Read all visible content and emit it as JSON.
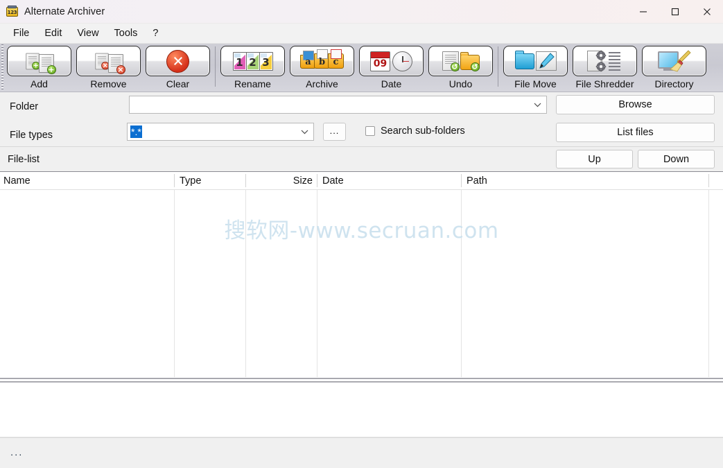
{
  "window": {
    "title": "Alternate Archiver",
    "icon": "archiver-123-icon",
    "controls": {
      "minimize": "minimize-icon",
      "maximize": "maximize-icon",
      "close": "close-icon"
    }
  },
  "menubar": {
    "items": [
      {
        "label": "File"
      },
      {
        "label": "Edit"
      },
      {
        "label": "View"
      },
      {
        "label": "Tools"
      },
      {
        "label": "?"
      }
    ]
  },
  "toolbar": {
    "buttons": [
      {
        "label": "Add",
        "icon": "add-documents-icon"
      },
      {
        "label": "Remove",
        "icon": "remove-documents-icon"
      },
      {
        "label": "Clear",
        "icon": "clear-red-x-icon"
      },
      {
        "label": "Rename",
        "icon": "rename-123-cards-icon"
      },
      {
        "label": "Archive",
        "icon": "archive-abc-folders-icon"
      },
      {
        "label": "Date",
        "icon": "date-calendar-clock-icon"
      },
      {
        "label": "Undo",
        "icon": "undo-document-folder-icon"
      },
      {
        "label": "File Move",
        "icon": "file-move-folder-pen-icon"
      },
      {
        "label": "File Shredder",
        "icon": "file-shredder-icon"
      },
      {
        "label": "Directory",
        "icon": "directory-broom-icon"
      }
    ]
  },
  "form": {
    "folder_label": "Folder",
    "folder_value": "",
    "folder_placeholder": "",
    "filetypes_label": "File types",
    "filetypes_value": "*.*",
    "browse_dots_label": "...",
    "search_subfolders_label": "Search sub-folders",
    "search_subfolders_checked": false,
    "browse_label": "Browse",
    "list_files_label": "List files"
  },
  "filelist": {
    "title": "File-list",
    "up_label": "Up",
    "down_label": "Down",
    "columns": [
      {
        "label": "Name",
        "align": "left"
      },
      {
        "label": "Type",
        "align": "left"
      },
      {
        "label": "Size",
        "align": "right"
      },
      {
        "label": "Date",
        "align": "left"
      },
      {
        "label": "Path",
        "align": "left"
      }
    ],
    "rows": []
  },
  "watermark": {
    "text": "搜软网-www.secruan.com",
    "color": "#cfe3ef"
  },
  "statusbar": {
    "text": "..."
  },
  "colors": {
    "titlebar_start": "#f3eff4",
    "titlebar_end": "#f8f0ef",
    "toolbar_bg": "#cfcfd6",
    "panel_bg": "#f0f0f0",
    "selection_blue": "#0a6ed1",
    "body_bg": "#ffffff"
  }
}
